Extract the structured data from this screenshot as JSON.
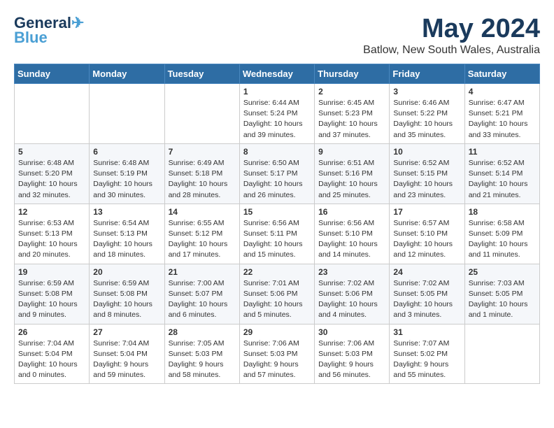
{
  "header": {
    "logo_line1": "General",
    "logo_line2": "Blue",
    "month": "May 2024",
    "location": "Batlow, New South Wales, Australia"
  },
  "weekdays": [
    "Sunday",
    "Monday",
    "Tuesday",
    "Wednesday",
    "Thursday",
    "Friday",
    "Saturday"
  ],
  "weeks": [
    [
      {
        "day": "",
        "info": ""
      },
      {
        "day": "",
        "info": ""
      },
      {
        "day": "",
        "info": ""
      },
      {
        "day": "1",
        "info": "Sunrise: 6:44 AM\nSunset: 5:24 PM\nDaylight: 10 hours\nand 39 minutes."
      },
      {
        "day": "2",
        "info": "Sunrise: 6:45 AM\nSunset: 5:23 PM\nDaylight: 10 hours\nand 37 minutes."
      },
      {
        "day": "3",
        "info": "Sunrise: 6:46 AM\nSunset: 5:22 PM\nDaylight: 10 hours\nand 35 minutes."
      },
      {
        "day": "4",
        "info": "Sunrise: 6:47 AM\nSunset: 5:21 PM\nDaylight: 10 hours\nand 33 minutes."
      }
    ],
    [
      {
        "day": "5",
        "info": "Sunrise: 6:48 AM\nSunset: 5:20 PM\nDaylight: 10 hours\nand 32 minutes."
      },
      {
        "day": "6",
        "info": "Sunrise: 6:48 AM\nSunset: 5:19 PM\nDaylight: 10 hours\nand 30 minutes."
      },
      {
        "day": "7",
        "info": "Sunrise: 6:49 AM\nSunset: 5:18 PM\nDaylight: 10 hours\nand 28 minutes."
      },
      {
        "day": "8",
        "info": "Sunrise: 6:50 AM\nSunset: 5:17 PM\nDaylight: 10 hours\nand 26 minutes."
      },
      {
        "day": "9",
        "info": "Sunrise: 6:51 AM\nSunset: 5:16 PM\nDaylight: 10 hours\nand 25 minutes."
      },
      {
        "day": "10",
        "info": "Sunrise: 6:52 AM\nSunset: 5:15 PM\nDaylight: 10 hours\nand 23 minutes."
      },
      {
        "day": "11",
        "info": "Sunrise: 6:52 AM\nSunset: 5:14 PM\nDaylight: 10 hours\nand 21 minutes."
      }
    ],
    [
      {
        "day": "12",
        "info": "Sunrise: 6:53 AM\nSunset: 5:13 PM\nDaylight: 10 hours\nand 20 minutes."
      },
      {
        "day": "13",
        "info": "Sunrise: 6:54 AM\nSunset: 5:13 PM\nDaylight: 10 hours\nand 18 minutes."
      },
      {
        "day": "14",
        "info": "Sunrise: 6:55 AM\nSunset: 5:12 PM\nDaylight: 10 hours\nand 17 minutes."
      },
      {
        "day": "15",
        "info": "Sunrise: 6:56 AM\nSunset: 5:11 PM\nDaylight: 10 hours\nand 15 minutes."
      },
      {
        "day": "16",
        "info": "Sunrise: 6:56 AM\nSunset: 5:10 PM\nDaylight: 10 hours\nand 14 minutes."
      },
      {
        "day": "17",
        "info": "Sunrise: 6:57 AM\nSunset: 5:10 PM\nDaylight: 10 hours\nand 12 minutes."
      },
      {
        "day": "18",
        "info": "Sunrise: 6:58 AM\nSunset: 5:09 PM\nDaylight: 10 hours\nand 11 minutes."
      }
    ],
    [
      {
        "day": "19",
        "info": "Sunrise: 6:59 AM\nSunset: 5:08 PM\nDaylight: 10 hours\nand 9 minutes."
      },
      {
        "day": "20",
        "info": "Sunrise: 6:59 AM\nSunset: 5:08 PM\nDaylight: 10 hours\nand 8 minutes."
      },
      {
        "day": "21",
        "info": "Sunrise: 7:00 AM\nSunset: 5:07 PM\nDaylight: 10 hours\nand 6 minutes."
      },
      {
        "day": "22",
        "info": "Sunrise: 7:01 AM\nSunset: 5:06 PM\nDaylight: 10 hours\nand 5 minutes."
      },
      {
        "day": "23",
        "info": "Sunrise: 7:02 AM\nSunset: 5:06 PM\nDaylight: 10 hours\nand 4 minutes."
      },
      {
        "day": "24",
        "info": "Sunrise: 7:02 AM\nSunset: 5:05 PM\nDaylight: 10 hours\nand 3 minutes."
      },
      {
        "day": "25",
        "info": "Sunrise: 7:03 AM\nSunset: 5:05 PM\nDaylight: 10 hours\nand 1 minute."
      }
    ],
    [
      {
        "day": "26",
        "info": "Sunrise: 7:04 AM\nSunset: 5:04 PM\nDaylight: 10 hours\nand 0 minutes."
      },
      {
        "day": "27",
        "info": "Sunrise: 7:04 AM\nSunset: 5:04 PM\nDaylight: 9 hours\nand 59 minutes."
      },
      {
        "day": "28",
        "info": "Sunrise: 7:05 AM\nSunset: 5:03 PM\nDaylight: 9 hours\nand 58 minutes."
      },
      {
        "day": "29",
        "info": "Sunrise: 7:06 AM\nSunset: 5:03 PM\nDaylight: 9 hours\nand 57 minutes."
      },
      {
        "day": "30",
        "info": "Sunrise: 7:06 AM\nSunset: 5:03 PM\nDaylight: 9 hours\nand 56 minutes."
      },
      {
        "day": "31",
        "info": "Sunrise: 7:07 AM\nSunset: 5:02 PM\nDaylight: 9 hours\nand 55 minutes."
      },
      {
        "day": "",
        "info": ""
      }
    ]
  ]
}
